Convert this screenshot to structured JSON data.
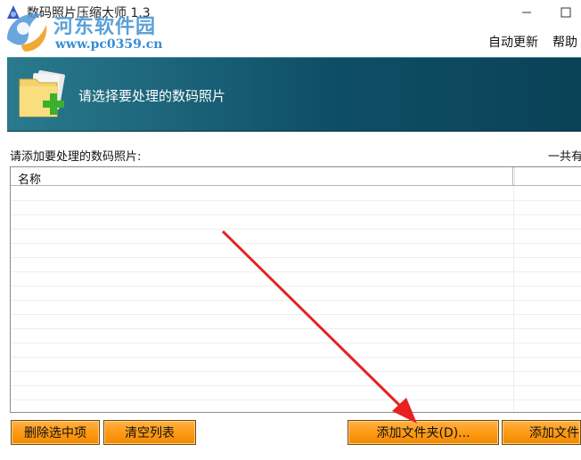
{
  "window": {
    "title": "数码照片压缩大师 1.3"
  },
  "watermark": {
    "line1": "河东软件园",
    "line2": "www.pc0359.cn"
  },
  "menu": {
    "items": [
      "自动更新",
      "帮助"
    ]
  },
  "banner": {
    "text": "请选择要处理的数码照片"
  },
  "list": {
    "label": "请添加要处理的数码照片:",
    "count_text": "一共有",
    "columns": [
      "名称",
      ""
    ],
    "rows": []
  },
  "buttons": {
    "delete_selected": "删除选中项",
    "clear_list": "清空列表",
    "add_folder": "添加文件夹(D)...",
    "add_file": "添加文件"
  },
  "colors": {
    "banner_start": "#2a7a8e",
    "banner_end": "#0a4257",
    "button_orange": "#ff9a14",
    "annotation_arrow": "#e82020"
  }
}
